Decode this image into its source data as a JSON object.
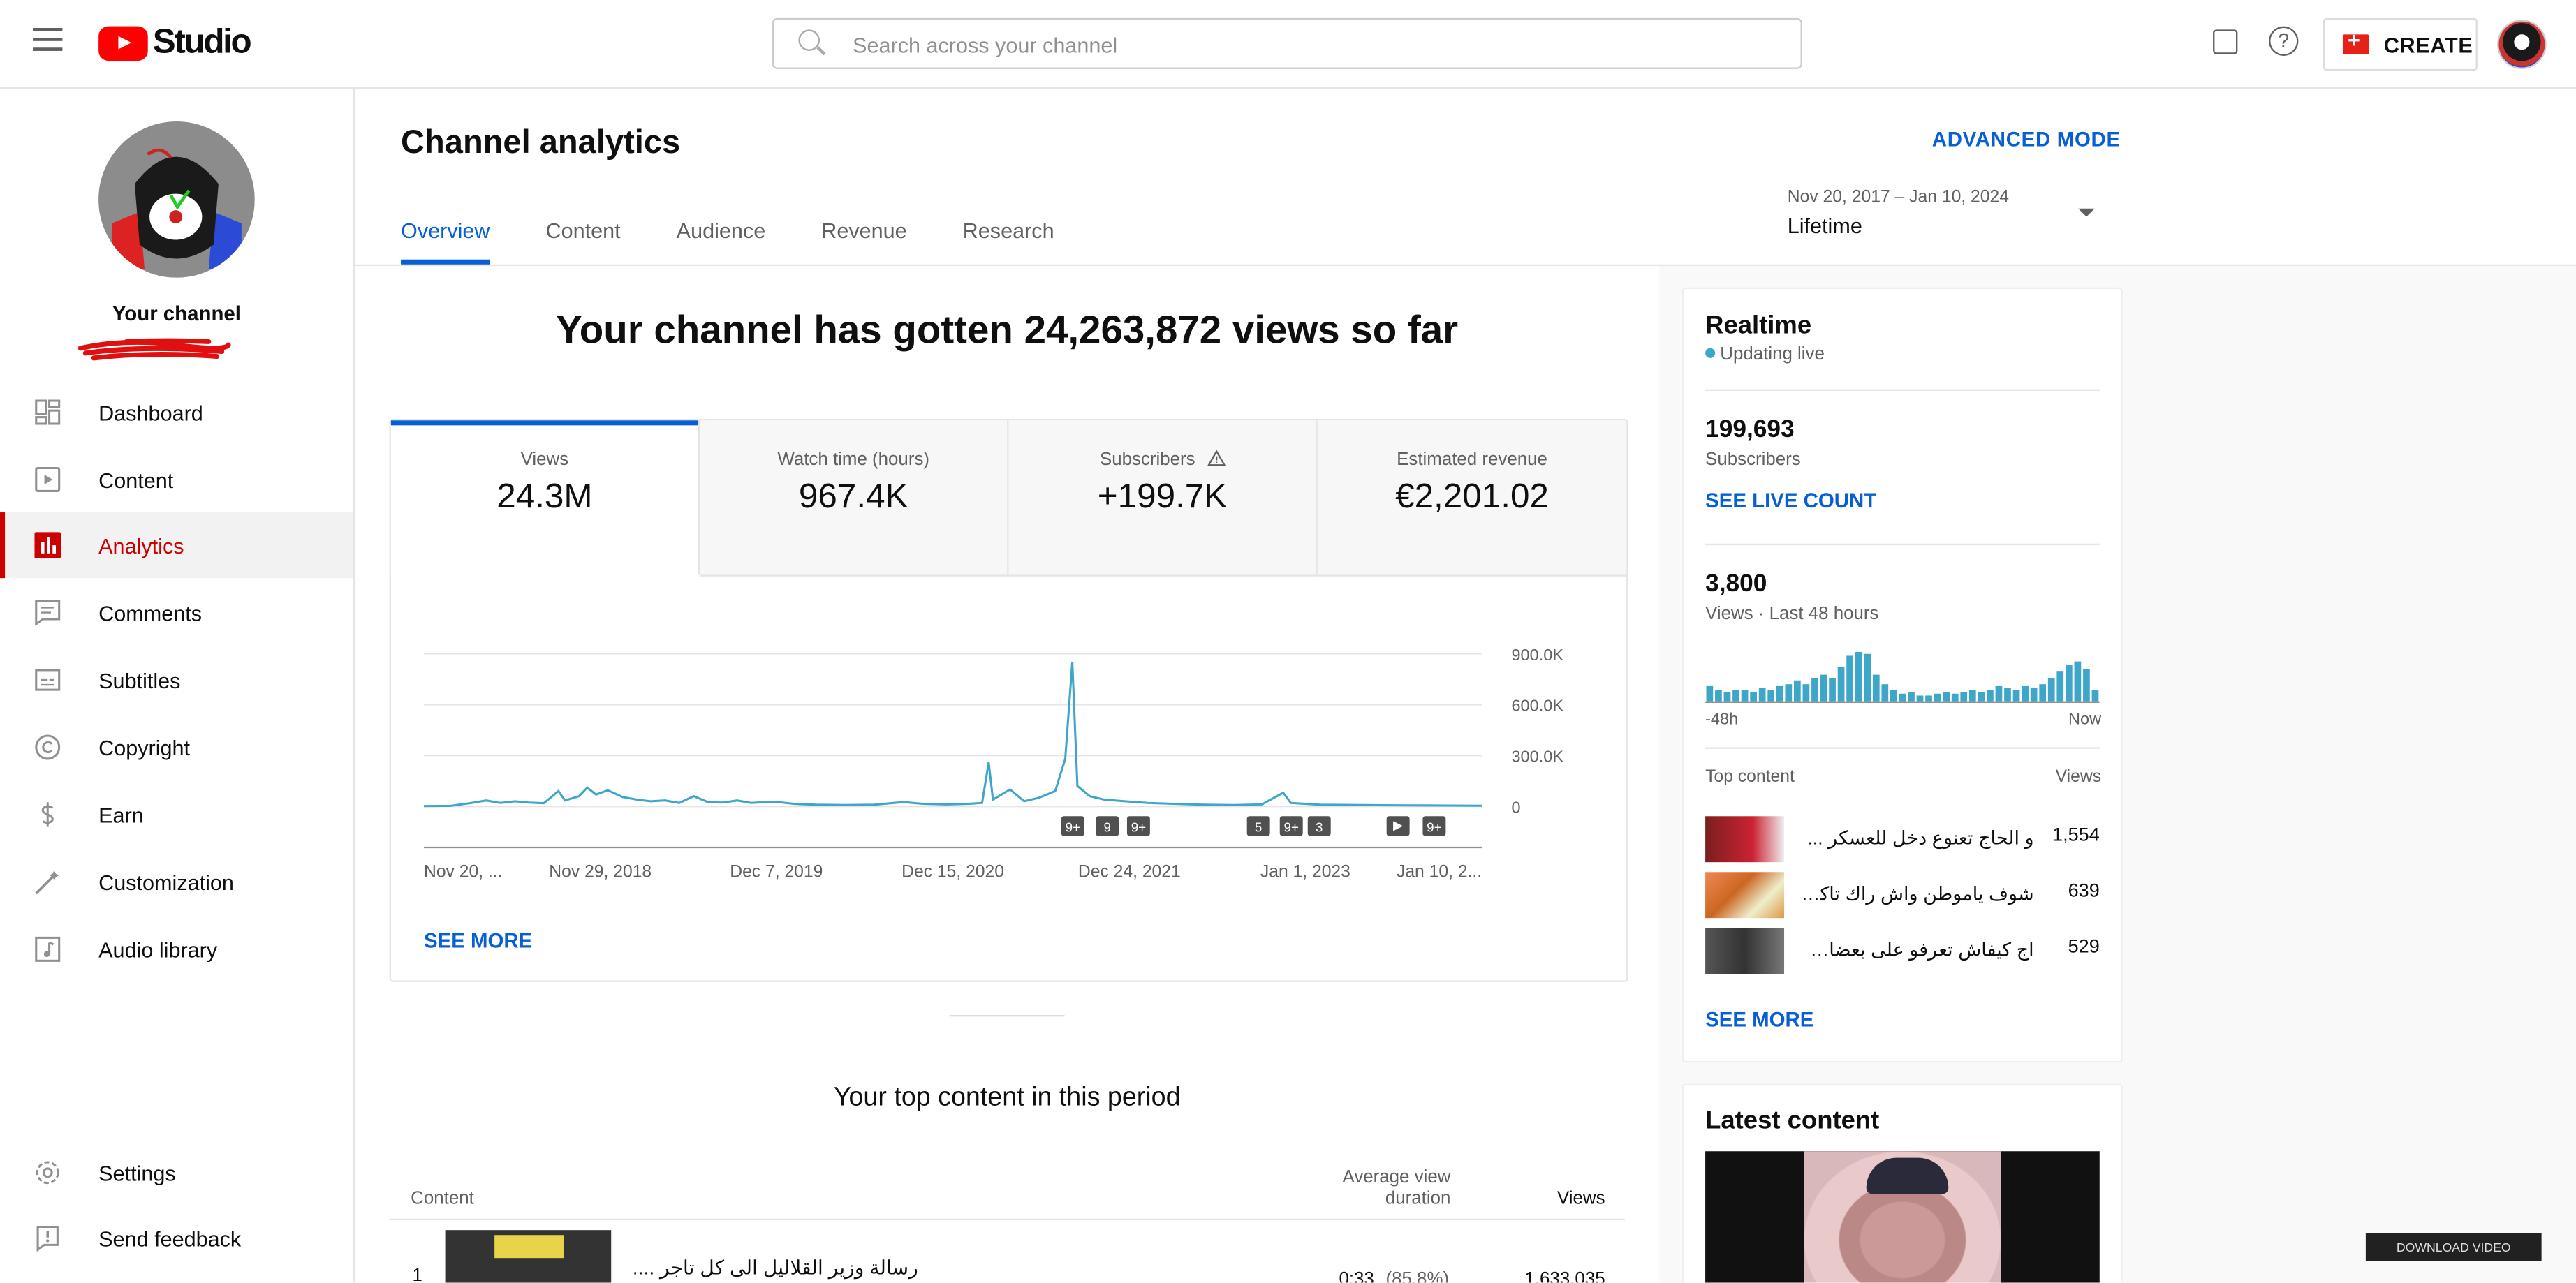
{
  "header": {
    "logo_text": "Studio",
    "search_placeholder": "Search across your channel",
    "help_label": "?",
    "create_label": "CREATE"
  },
  "sidebar": {
    "channel_label": "Your channel",
    "items": [
      {
        "label": "Dashboard",
        "icon": "dashboard-icon"
      },
      {
        "label": "Content",
        "icon": "content-icon"
      },
      {
        "label": "Analytics",
        "icon": "analytics-icon",
        "active": true
      },
      {
        "label": "Comments",
        "icon": "comments-icon"
      },
      {
        "label": "Subtitles",
        "icon": "subtitles-icon"
      },
      {
        "label": "Copyright",
        "icon": "copyright-icon"
      },
      {
        "label": "Earn",
        "icon": "earn-icon"
      },
      {
        "label": "Customization",
        "icon": "customization-icon"
      },
      {
        "label": "Audio library",
        "icon": "audio-library-icon"
      }
    ],
    "bottom_items": [
      {
        "label": "Settings",
        "icon": "settings-icon"
      },
      {
        "label": "Send feedback",
        "icon": "send-feedback-icon"
      }
    ]
  },
  "page": {
    "title": "Channel analytics",
    "advanced_mode": "ADVANCED MODE",
    "tabs": [
      "Overview",
      "Content",
      "Audience",
      "Revenue",
      "Research"
    ],
    "active_tab": "Overview",
    "date_range": "Nov 20, 2017 – Jan 10, 2024",
    "date_preset": "Lifetime"
  },
  "overview": {
    "headline": "Your channel has gotten 24,263,872 views so far",
    "kpis": [
      {
        "label": "Views",
        "value": "24.3M",
        "active": true
      },
      {
        "label": "Watch time (hours)",
        "value": "967.4K"
      },
      {
        "label": "Subscribers",
        "value": "+199.7K",
        "warning": true
      },
      {
        "label": "Estimated revenue",
        "value": "€2,201.02"
      }
    ],
    "see_more": "SEE MORE",
    "markers": [
      "9+",
      "9",
      "9+",
      "5",
      "9+",
      "3",
      "9+"
    ],
    "marker_play_icon": "play-icon"
  },
  "chart_data": {
    "type": "line",
    "title": "",
    "xlabel": "",
    "ylabel": "",
    "x_ticks": [
      "Nov 20, ...",
      "Nov 29, 2018",
      "Dec 7, 2019",
      "Dec 15, 2020",
      "Dec 24, 2021",
      "Jan 1, 2023",
      "Jan 10, 2..."
    ],
    "y_ticks": [
      "0",
      "300.0K",
      "600.0K",
      "900.0K"
    ],
    "ylim": [
      0,
      900000
    ],
    "series": [
      {
        "points": [
          [
            "2017-11-20",
            2000
          ],
          [
            "2018-01-15",
            3000
          ],
          [
            "2018-03-01",
            20000
          ],
          [
            "2018-04-01",
            35000
          ],
          [
            "2018-05-01",
            20000
          ],
          [
            "2018-06-01",
            30000
          ],
          [
            "2018-07-01",
            22000
          ],
          [
            "2018-08-01",
            18000
          ],
          [
            "2018-09-01",
            90000
          ],
          [
            "2018-09-15",
            35000
          ],
          [
            "2018-10-15",
            60000
          ],
          [
            "2018-11-01",
            110000
          ],
          [
            "2018-11-20",
            70000
          ],
          [
            "2018-12-15",
            95000
          ],
          [
            "2019-01-15",
            55000
          ],
          [
            "2019-02-15",
            40000
          ],
          [
            "2019-03-15",
            30000
          ],
          [
            "2019-04-15",
            35000
          ],
          [
            "2019-05-15",
            20000
          ],
          [
            "2019-06-15",
            60000
          ],
          [
            "2019-07-15",
            25000
          ],
          [
            "2019-08-15",
            22000
          ],
          [
            "2019-09-15",
            35000
          ],
          [
            "2019-10-15",
            20000
          ],
          [
            "2019-12-01",
            28000
          ],
          [
            "2020-01-15",
            15000
          ],
          [
            "2020-03-01",
            10000
          ],
          [
            "2020-05-01",
            8000
          ],
          [
            "2020-07-01",
            10000
          ],
          [
            "2020-09-01",
            25000
          ],
          [
            "2020-10-15",
            15000
          ],
          [
            "2020-12-01",
            12000
          ],
          [
            "2021-01-15",
            15000
          ],
          [
            "2021-02-15",
            20000
          ],
          [
            "2021-03-01",
            260000
          ],
          [
            "2021-03-10",
            40000
          ],
          [
            "2021-04-15",
            100000
          ],
          [
            "2021-05-15",
            30000
          ],
          [
            "2021-06-15",
            50000
          ],
          [
            "2021-07-20",
            90000
          ],
          [
            "2021-08-10",
            280000
          ],
          [
            "2021-08-25",
            850000
          ],
          [
            "2021-09-05",
            120000
          ],
          [
            "2021-10-01",
            60000
          ],
          [
            "2021-11-01",
            40000
          ],
          [
            "2021-12-15",
            30000
          ],
          [
            "2022-02-01",
            20000
          ],
          [
            "2022-04-01",
            15000
          ],
          [
            "2022-06-01",
            10000
          ],
          [
            "2022-08-01",
            8000
          ],
          [
            "2022-10-01",
            12000
          ],
          [
            "2022-11-15",
            80000
          ],
          [
            "2022-12-01",
            20000
          ],
          [
            "2023-02-01",
            10000
          ],
          [
            "2023-05-01",
            8000
          ],
          [
            "2023-08-01",
            6000
          ],
          [
            "2023-11-01",
            5000
          ],
          [
            "2024-01-10",
            4000
          ]
        ]
      }
    ],
    "grid": true
  },
  "top_content": {
    "title": "Your top content in this period",
    "columns": [
      "Content",
      "Average view duration",
      "Views"
    ],
    "rows": [
      {
        "rank": "1",
        "title": "رسالة وزير القلاليل الى كل تاجر ....",
        "duration": "0:33",
        "duration_pct": "(85.8%)",
        "views": "1,633,035"
      }
    ]
  },
  "realtime": {
    "title": "Realtime",
    "status": "Updating live",
    "subscribers_value": "199,693",
    "subscribers_label": "Subscribers",
    "see_live_count": "SEE LIVE COUNT",
    "views_value": "3,800",
    "views_label": "Views · Last 48 hours",
    "axis_start": "-48h",
    "axis_end": "Now",
    "bars": [
      8,
      6,
      5,
      6,
      6,
      5,
      7,
      6,
      8,
      9,
      11,
      9,
      12,
      14,
      12,
      18,
      24,
      26,
      25,
      14,
      9,
      6,
      4,
      5,
      3,
      3,
      4,
      5,
      4,
      5,
      6,
      5,
      6,
      8,
      7,
      6,
      8,
      7,
      9,
      12,
      16,
      19,
      21,
      17,
      6
    ],
    "top_content_label": "Top content",
    "top_content_views_label": "Views",
    "top_items": [
      {
        "title": "و الحاج تعنوع دخل للعسكر ...",
        "views": "1,554"
      },
      {
        "title": "شوف ياموطن واش راك تاكل...",
        "views": "639"
      },
      {
        "title": "اج كيفاش تعرفو على بعضاهم...",
        "views": "529"
      }
    ],
    "see_more": "SEE MORE"
  },
  "latest": {
    "title": "Latest content",
    "download_label": "DOWNLOAD VIDEO"
  },
  "colors": {
    "accent": "#065fd4",
    "active_nav": "#cc0000",
    "chart_line": "#3ea6c8",
    "brand_red": "#ff0000"
  }
}
